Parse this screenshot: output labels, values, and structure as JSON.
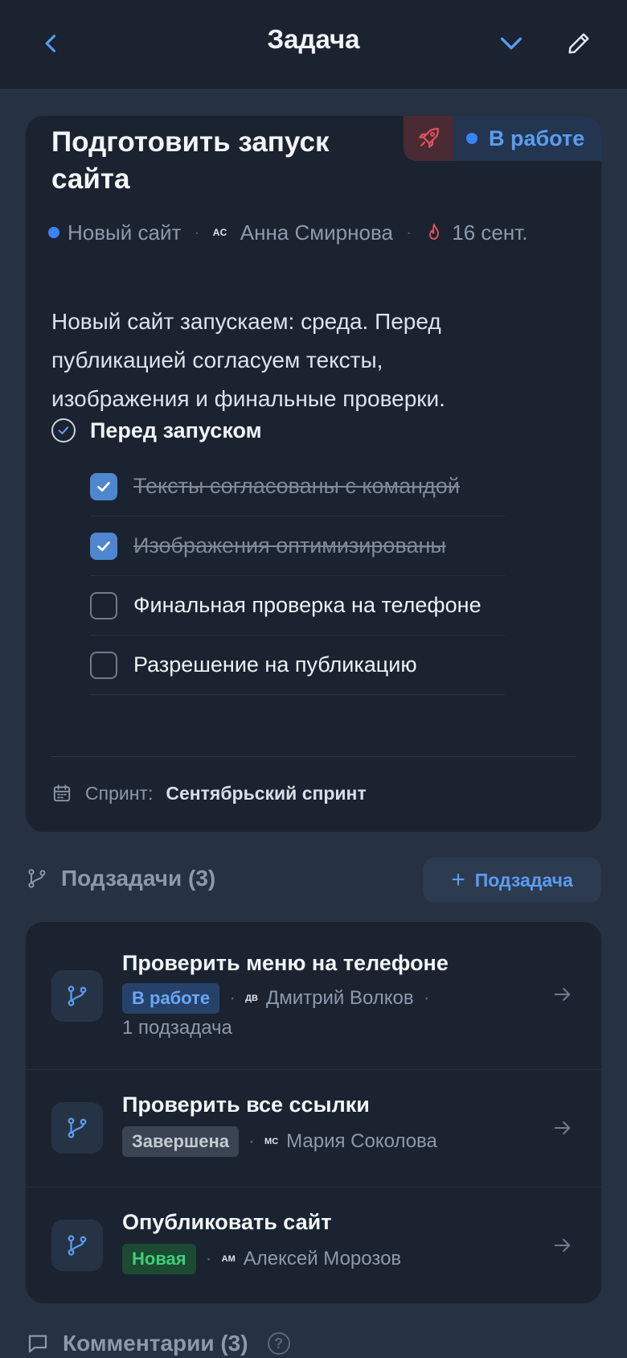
{
  "header": {
    "title": "Задача"
  },
  "task": {
    "title": "Подготовить запуск сайта",
    "status": "В работе",
    "project": "Новый сайт",
    "assignee_initials": "АС",
    "assignee": "Анна Смирнова",
    "due": "16 сент.",
    "description": "Новый сайт запускаем: среда. Перед публикацией согласуем тексты, изображения и финальные проверки.",
    "checklist": {
      "title": "Перед запуском",
      "items": [
        {
          "label": "Тексты согласованы с командой",
          "done": true
        },
        {
          "label": "Изображения оптимизированы",
          "done": true
        },
        {
          "label": "Финальная проверка на телефоне",
          "done": false
        },
        {
          "label": "Разрешение на публикацию",
          "done": false
        }
      ]
    },
    "sprint_label": "Спринт:",
    "sprint": "Сентябрьский спринт"
  },
  "subtasks": {
    "header": "Подзадачи (3)",
    "add_label": "Подзадача",
    "items": [
      {
        "title": "Проверить меню на телефоне",
        "status": "В работе",
        "initials": "ДВ",
        "assignee": "Дмитрий Волков",
        "extra": "1 подзадача"
      },
      {
        "title": "Проверить все ссылки",
        "status": "Завершена",
        "initials": "МС",
        "assignee": "Мария Соколова"
      },
      {
        "title": "Опубликовать сайт",
        "status": "Новая",
        "initials": "АМ",
        "assignee": "Алексей Морозов"
      }
    ]
  },
  "comments": {
    "header": "Комментарии (3)",
    "help": "?"
  },
  "colors": {
    "accent": "#3b82f6",
    "danger": "#e05260",
    "success": "#3ecf7a",
    "background": "#263142",
    "card": "#1b2330"
  }
}
